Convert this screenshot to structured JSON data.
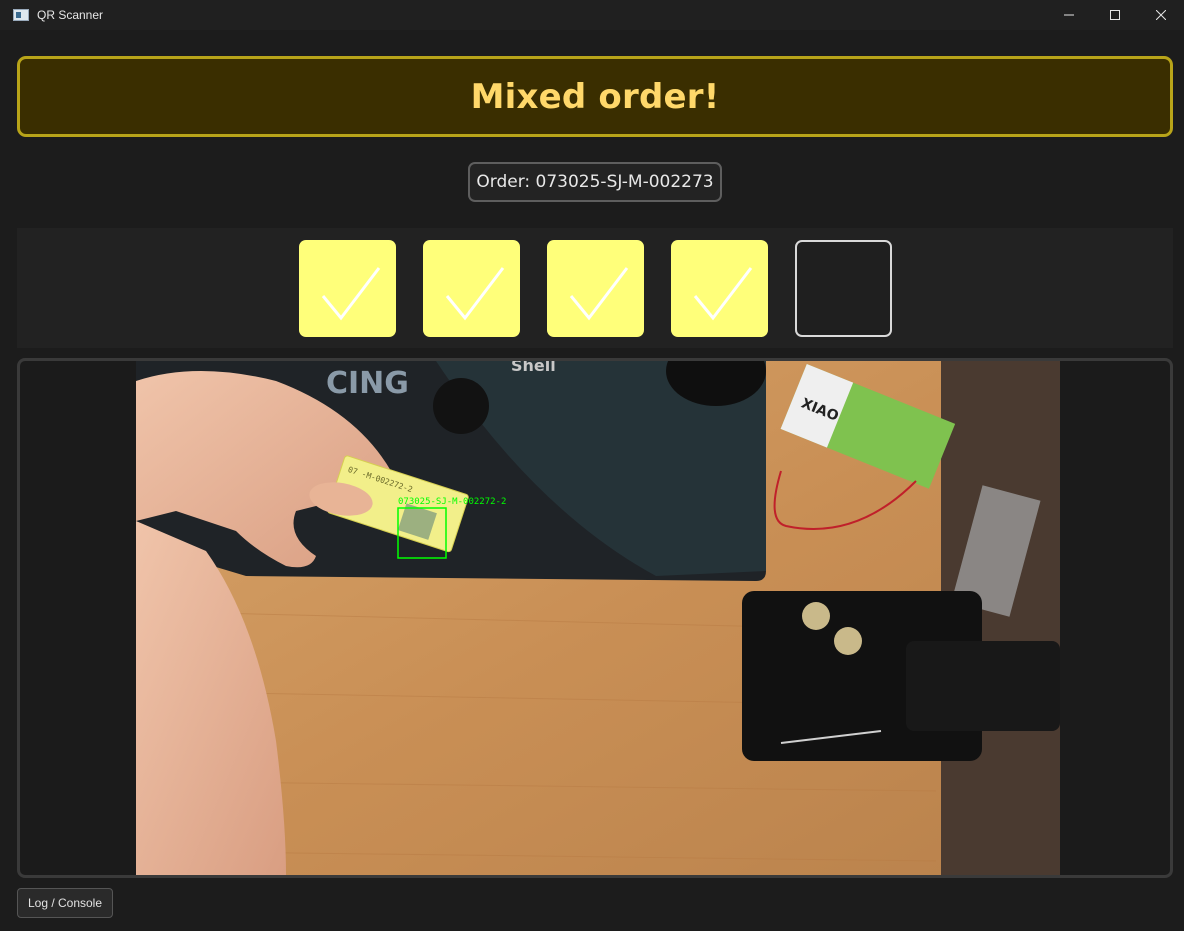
{
  "window": {
    "title": "QR Scanner",
    "controls": [
      "minimize-icon",
      "maximize-icon",
      "close-icon"
    ]
  },
  "status_banner": {
    "text": "Mixed order!",
    "text_color": "#ffd86a",
    "background": "#3a2e00",
    "border_color": "#b8a419"
  },
  "order": {
    "label": "Order: 073025-SJ-M-002273"
  },
  "slots": {
    "total": 5,
    "completed": 4,
    "items": [
      {
        "state": "checked",
        "icon": "checkmark-icon"
      },
      {
        "state": "checked",
        "icon": "checkmark-icon"
      },
      {
        "state": "checked",
        "icon": "checkmark-icon"
      },
      {
        "state": "checked",
        "icon": "checkmark-icon"
      },
      {
        "state": "empty",
        "icon": ""
      }
    ],
    "checked_color": "#ffff7a"
  },
  "camera": {
    "detection_label": "073025-SJ-M-002272-2",
    "detection_color": "#00ff00",
    "card_text": "07 -M-002272-2"
  },
  "footer": {
    "log_button_label": "Log / Console"
  }
}
